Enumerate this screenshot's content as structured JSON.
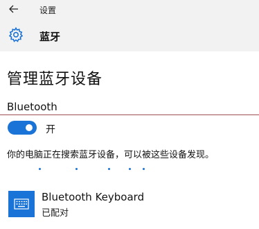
{
  "titlebar": {
    "title": "设置",
    "back_icon": "back-arrow-icon"
  },
  "header": {
    "title": "蓝牙",
    "icon": "gear-icon"
  },
  "main": {
    "page_title": "管理蓝牙设备",
    "section_label": "Bluetooth",
    "toggle": {
      "state_label": "开",
      "on": true
    },
    "search_status": "你的电脑正在搜索蓝牙设备，可以被这些设备发现。"
  },
  "devices": [
    {
      "name": "Bluetooth Keyboard",
      "status": "已配对",
      "icon": "keyboard-icon"
    }
  ],
  "colors": {
    "accent": "#1a73d6",
    "header_bg": "#f2f2f2"
  }
}
